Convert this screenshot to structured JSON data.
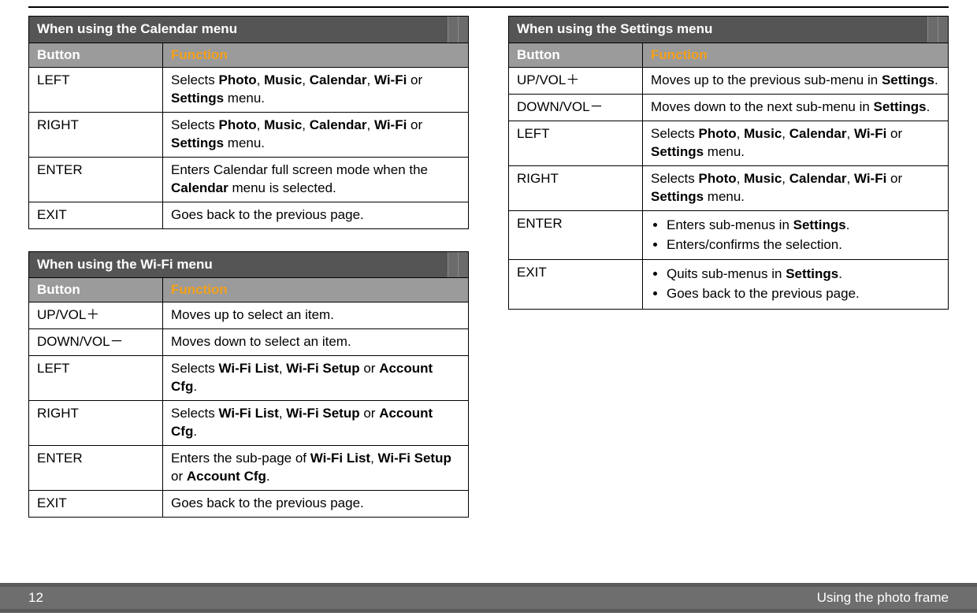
{
  "footer": {
    "page_number": "12",
    "section_title": "Using the photo frame"
  },
  "headers": {
    "button": "Button",
    "function": "Function"
  },
  "tables": {
    "calendar": {
      "title": "When using the Calendar menu",
      "rows": [
        {
          "button": "LEFT",
          "function_html": "Selects <b>Photo</b>, <b>Music</b>, <b>Calendar</b>, <b>Wi-Fi</b> or <b>Settings</b> menu."
        },
        {
          "button": "RIGHT",
          "function_html": "Selects <b>Photo</b>, <b>Music</b>, <b>Calendar</b>, <b>Wi-Fi</b> or <b>Settings</b> menu."
        },
        {
          "button": "ENTER",
          "function_html": "Enters Calendar full screen mode when the <b>Calendar</b> menu is selected."
        },
        {
          "button": "EXIT",
          "function_html": "Goes back to the previous page."
        }
      ]
    },
    "wifi": {
      "title": "When using the Wi-Fi menu",
      "rows": [
        {
          "button": "UP/VOL＋",
          "function_html": "Moves up to select an item."
        },
        {
          "button": "DOWN/VOL－",
          "function_html": "Moves down to select an item."
        },
        {
          "button": "LEFT",
          "function_html": "Selects <b>Wi-Fi List</b>, <b>Wi-Fi Setup</b> or <b>Account Cfg</b>."
        },
        {
          "button": "RIGHT",
          "function_html": "Selects <b>Wi-Fi List</b>, <b>Wi-Fi Setup</b> or <b>Account Cfg</b>."
        },
        {
          "button": "ENTER",
          "function_html": "Enters the sub-page of <b>Wi-Fi List</b>, <b>Wi-Fi Setup</b> or <b>Account Cfg</b>."
        },
        {
          "button": "EXIT",
          "function_html": "Goes back to the previous page."
        }
      ]
    },
    "settings": {
      "title": "When using the Settings menu",
      "rows": [
        {
          "button": "UP/VOL＋",
          "function_html": "Moves up to the previous sub-menu in <b>Settings</b>."
        },
        {
          "button": "DOWN/VOL－",
          "function_html": "Moves down to the next sub-menu in <b>Settings</b>."
        },
        {
          "button": "LEFT",
          "function_html": "Selects <b>Photo</b>, <b>Music</b>, <b>Calendar</b>, <b>Wi-Fi</b> or <b>Settings</b> menu."
        },
        {
          "button": "RIGHT",
          "function_html": "Selects <b>Photo</b>, <b>Music</b>, <b>Calendar</b>, <b>Wi-Fi</b> or <b>Settings</b> menu."
        },
        {
          "button": "ENTER",
          "function_bullets_html": [
            "Enters sub-menus in <b>Settings</b>.",
            "Enters/confirms the selection."
          ]
        },
        {
          "button": "EXIT",
          "function_bullets_html": [
            "Quits sub-menus in <b>Settings</b>.",
            "Goes back to the previous page."
          ]
        }
      ]
    }
  }
}
